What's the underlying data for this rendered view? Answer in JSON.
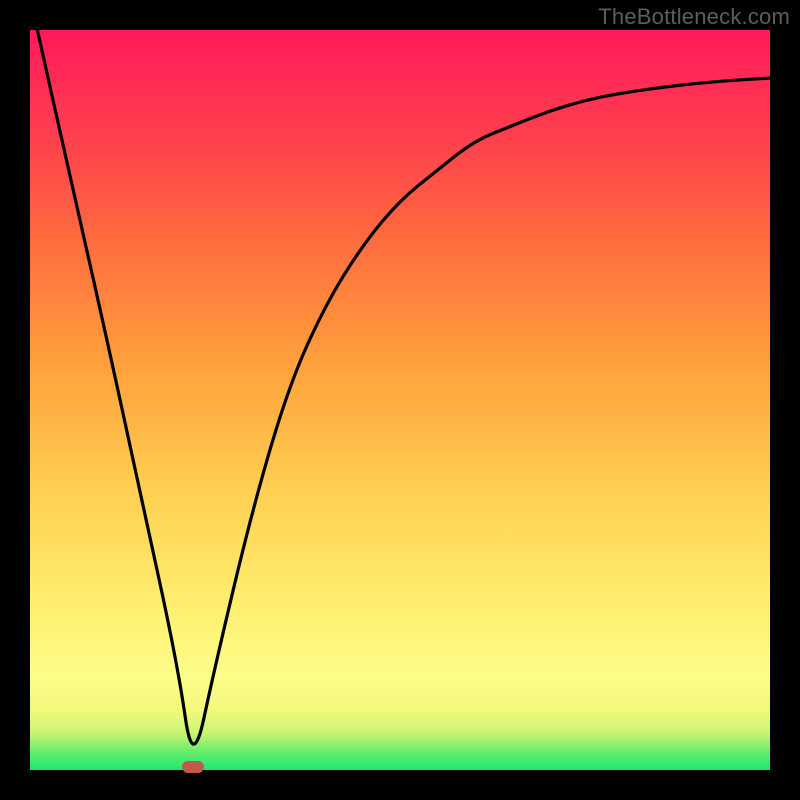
{
  "watermark": "TheBottleneck.com",
  "chart_data": {
    "type": "line",
    "title": "",
    "xlabel": "",
    "ylabel": "",
    "xlim": [
      0,
      100
    ],
    "ylim": [
      0,
      100
    ],
    "series": [
      {
        "name": "curve",
        "x": [
          1,
          5,
          10,
          15,
          20,
          22,
          25,
          30,
          35,
          40,
          45,
          50,
          55,
          60,
          65,
          70,
          75,
          80,
          85,
          90,
          95,
          100
        ],
        "y": [
          100,
          82,
          60,
          37,
          14,
          0,
          14,
          35,
          52,
          63,
          71,
          77,
          81,
          85,
          87,
          89,
          90.5,
          91.5,
          92.2,
          92.8,
          93.2,
          93.5
        ]
      }
    ],
    "min_marker": {
      "x": 22,
      "y": 0
    },
    "gradient_stops": [
      {
        "pos": 0,
        "color": "#1ee86f"
      },
      {
        "pos": 5,
        "color": "#c9f573"
      },
      {
        "pos": 13,
        "color": "#fdfd8a"
      },
      {
        "pos": 38,
        "color": "#ffcf50"
      },
      {
        "pos": 72,
        "color": "#ff6a3e"
      },
      {
        "pos": 100,
        "color": "#ff1a5a"
      }
    ]
  }
}
